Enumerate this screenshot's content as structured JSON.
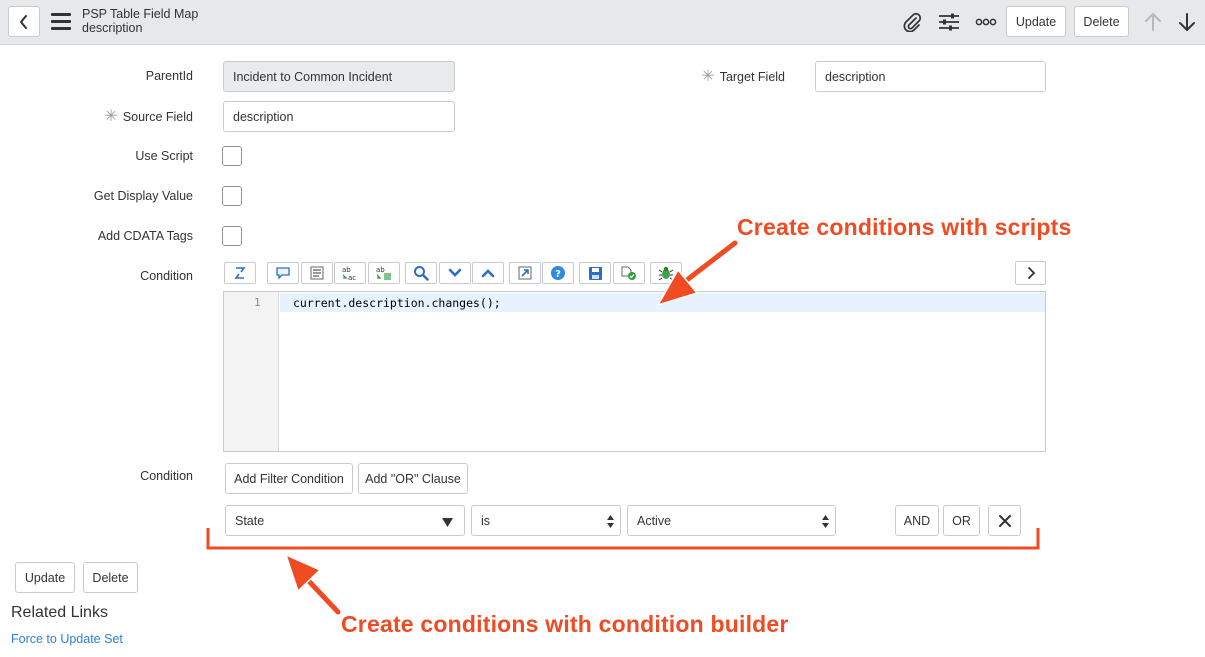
{
  "header": {
    "title_line1": "PSP Table Field Map",
    "title_line2": "description",
    "update_label": "Update",
    "delete_label": "Delete"
  },
  "form": {
    "parent_id": {
      "label": "ParentId",
      "value": "Incident to Common Incident"
    },
    "target_field": {
      "label": "Target Field",
      "value": "description",
      "required": true
    },
    "source_field": {
      "label": "Source Field",
      "value": "description",
      "required": true
    },
    "use_script": {
      "label": "Use Script",
      "checked": false
    },
    "get_display_value": {
      "label": "Get Display Value",
      "checked": false
    },
    "add_cdata_tags": {
      "label": "Add CDATA Tags",
      "checked": false
    },
    "condition_script": {
      "label": "Condition",
      "line_number": "1",
      "code": "current.description.changes();"
    },
    "condition_builder": {
      "label": "Condition",
      "add_filter_label": "Add Filter Condition",
      "add_or_label": "Add \"OR\" Clause",
      "field": "State",
      "operator": "is",
      "value": "Active",
      "and_label": "AND",
      "or_label": "OR"
    }
  },
  "footer": {
    "update_label": "Update",
    "delete_label": "Delete",
    "related_links_title": "Related Links",
    "related_link": "Force to Update Set"
  },
  "annotations": {
    "scripts": "Create conditions with scripts",
    "builder": "Create conditions with condition builder"
  },
  "colors": {
    "header_bg": "#e6e8ea",
    "annotation": "#f04b23",
    "link": "#2d7fd7",
    "toolbar_icon_blue": "#2e6dc2"
  }
}
